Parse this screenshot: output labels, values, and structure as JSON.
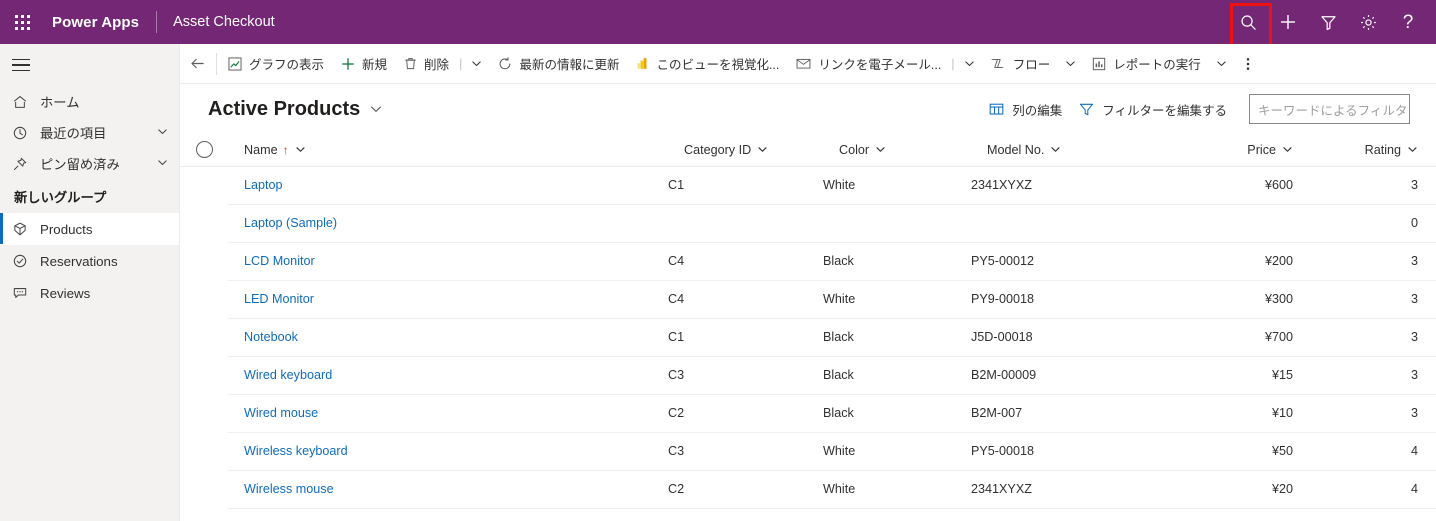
{
  "topbar": {
    "waffle_label": "waffle",
    "brand": "Power Apps",
    "app_name": "Asset Checkout",
    "icons": [
      {
        "name": "search-icon",
        "label": "Search",
        "highlighted": true
      },
      {
        "name": "plus-icon",
        "label": "New"
      },
      {
        "name": "filter-icon",
        "label": "Filter"
      },
      {
        "name": "gear-icon",
        "label": "Settings"
      },
      {
        "name": "help-icon",
        "label": "?"
      }
    ],
    "accent_color": "#742774",
    "highlight_color": "#ee1111"
  },
  "sidebar": {
    "menu_label": "Menu",
    "items": [
      {
        "label": "ホーム",
        "icon": "home-icon",
        "chevron": false
      },
      {
        "label": "最近の項目",
        "icon": "clock-icon",
        "chevron": true
      },
      {
        "label": "ピン留め済み",
        "icon": "pin-icon",
        "chevron": true
      }
    ],
    "group_title": "新しいグループ",
    "entities": [
      {
        "label": "Products",
        "icon": "box-icon",
        "selected": true
      },
      {
        "label": "Reservations",
        "icon": "check-circle-icon",
        "selected": false
      },
      {
        "label": "Reviews",
        "icon": "comment-icon",
        "selected": false
      }
    ],
    "selected_accent": "#0b6cbf"
  },
  "commandbar": {
    "back_label": "戻る",
    "commands": [
      {
        "label": "グラフの表示",
        "icon": "chart-icon"
      },
      {
        "label": "新規",
        "icon": "plus-icon"
      },
      {
        "label": "削除",
        "icon": "trash-icon"
      },
      {
        "label": "最新の情報に更新",
        "icon": "refresh-icon"
      },
      {
        "label": "このビューを視覚化...",
        "icon": "powerbi-icon"
      },
      {
        "label": "リンクを電子メール...",
        "icon": "email-icon"
      },
      {
        "label": "フロー",
        "icon": "flow-icon"
      },
      {
        "label": "レポートの実行",
        "icon": "report-icon"
      }
    ],
    "overflow_label": "その他のコマンド"
  },
  "view": {
    "title": "Active Products",
    "edit_columns_label": "列の編集",
    "edit_filters_label": "フィルターを編集する",
    "filter_placeholder": "キーワードによるフィルタ",
    "filter_value": ""
  },
  "grid": {
    "select_all_label": "すべて選択",
    "columns": [
      {
        "key": "name",
        "label": "Name",
        "align": "left",
        "sorted": true,
        "sort_dir": "↑"
      },
      {
        "key": "cat",
        "label": "Category ID",
        "align": "left",
        "sorted": false
      },
      {
        "key": "color",
        "label": "Color",
        "align": "left",
        "sorted": false
      },
      {
        "key": "model",
        "label": "Model No.",
        "align": "left",
        "sorted": false
      },
      {
        "key": "price",
        "label": "Price",
        "align": "right",
        "sorted": false
      },
      {
        "key": "rating",
        "label": "Rating",
        "align": "right",
        "sorted": false
      }
    ],
    "rows": [
      {
        "name": "Laptop",
        "cat": "C1",
        "color": "White",
        "model": "2341XYXZ",
        "price": "¥600",
        "rating": "3"
      },
      {
        "name": "Laptop (Sample)",
        "cat": "",
        "color": "",
        "model": "",
        "price": "",
        "rating": "0"
      },
      {
        "name": "LCD Monitor",
        "cat": "C4",
        "color": "Black",
        "model": "PY5-00012",
        "price": "¥200",
        "rating": "3"
      },
      {
        "name": "LED Monitor",
        "cat": "C4",
        "color": "White",
        "model": "PY9-00018",
        "price": "¥300",
        "rating": "3"
      },
      {
        "name": "Notebook",
        "cat": "C1",
        "color": "Black",
        "model": "J5D-00018",
        "price": "¥700",
        "rating": "3"
      },
      {
        "name": "Wired keyboard",
        "cat": "C3",
        "color": "Black",
        "model": "B2M-00009",
        "price": "¥15",
        "rating": "3"
      },
      {
        "name": "Wired mouse",
        "cat": "C2",
        "color": "Black",
        "model": "B2M-007",
        "price": "¥10",
        "rating": "3"
      },
      {
        "name": "Wireless keyboard",
        "cat": "C3",
        "color": "White",
        "model": "PY5-00018",
        "price": "¥50",
        "rating": "4"
      },
      {
        "name": "Wireless mouse",
        "cat": "C2",
        "color": "White",
        "model": "2341XYXZ",
        "price": "¥20",
        "rating": "4"
      }
    ],
    "link_color": "#0f6cbd",
    "sort_arrow_color": "#d83b01"
  }
}
